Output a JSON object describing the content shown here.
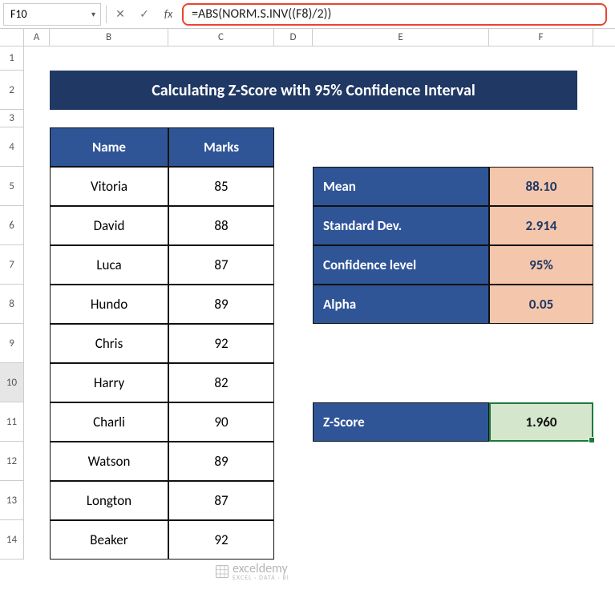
{
  "active_cell": "F10",
  "formula": "=ABS(NORM.S.INV((F8)/2))",
  "title": "Calculating Z-Score with 95% Confidence Interval",
  "columns": [
    "A",
    "B",
    "C",
    "D",
    "E",
    "F"
  ],
  "rows": [
    "1",
    "2",
    "3",
    "4",
    "5",
    "6",
    "7",
    "8",
    "9",
    "10",
    "11",
    "12",
    "13",
    "14"
  ],
  "data_table": {
    "headers": {
      "name": "Name",
      "marks": "Marks"
    },
    "rows": [
      {
        "name": "Vitoria",
        "marks": "85"
      },
      {
        "name": "David",
        "marks": "88"
      },
      {
        "name": "Luca",
        "marks": "87"
      },
      {
        "name": "Hundo",
        "marks": "89"
      },
      {
        "name": "Chris",
        "marks": "92"
      },
      {
        "name": "Harry",
        "marks": "82"
      },
      {
        "name": "Charli",
        "marks": "90"
      },
      {
        "name": "Watson",
        "marks": "89"
      },
      {
        "name": "Longton",
        "marks": "87"
      },
      {
        "name": "Beaker",
        "marks": "92"
      }
    ]
  },
  "stats": [
    {
      "label": "Mean",
      "value": "88.10"
    },
    {
      "label": "Standard Dev.",
      "value": "2.914"
    },
    {
      "label": "Confidence level",
      "value": "95%"
    },
    {
      "label": "Alpha",
      "value": "0.05"
    }
  ],
  "zscore": {
    "label": "Z-Score",
    "value": "1.960"
  },
  "watermark": {
    "brand": "exceldemy",
    "tagline": "EXCEL · DATA · BI"
  },
  "chart_data": {
    "type": "table",
    "title": "Calculating Z-Score with 95% Confidence Interval",
    "series": [
      {
        "name": "Vitoria",
        "values": [
          85
        ]
      },
      {
        "name": "David",
        "values": [
          88
        ]
      },
      {
        "name": "Luca",
        "values": [
          87
        ]
      },
      {
        "name": "Hundo",
        "values": [
          89
        ]
      },
      {
        "name": "Chris",
        "values": [
          92
        ]
      },
      {
        "name": "Harry",
        "values": [
          82
        ]
      },
      {
        "name": "Charli",
        "values": [
          90
        ]
      },
      {
        "name": "Watson",
        "values": [
          89
        ]
      },
      {
        "name": "Longton",
        "values": [
          87
        ]
      },
      {
        "name": "Beaker",
        "values": [
          92
        ]
      }
    ],
    "summary": {
      "mean": 88.1,
      "standard_deviation": 2.914,
      "confidence_level": 0.95,
      "alpha": 0.05,
      "z_score": 1.96
    }
  }
}
